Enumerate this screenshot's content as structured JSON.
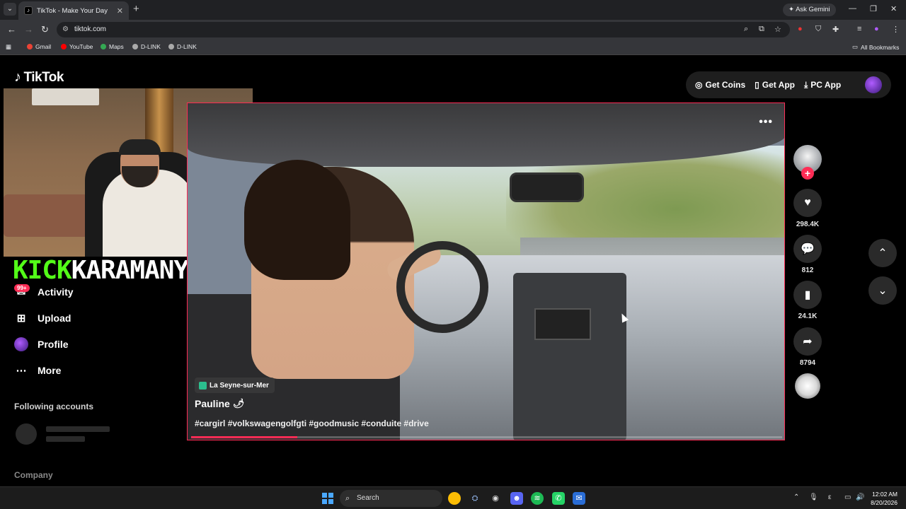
{
  "browser": {
    "tab_title": "TikTok - Make Your Day",
    "ask_gemini": "Ask Gemini",
    "url": "tiktok.com",
    "bookmarks": [
      "Gmail",
      "YouTube",
      "Maps",
      "D-LINK",
      "D-LINK"
    ],
    "all_bookmarks": "All Bookmarks"
  },
  "header": {
    "logo": "TikTok",
    "get_coins": "Get Coins",
    "get_app": "Get App",
    "pc_app": "PC App"
  },
  "overlay": {
    "kick_word": "KICK",
    "streamer_word": "KARAMANY"
  },
  "sidebar": {
    "activity_badge": "99+",
    "items": [
      {
        "label": "Activity",
        "icon": "inbox-icon"
      },
      {
        "label": "Upload",
        "icon": "plus-square-icon"
      },
      {
        "label": "Profile",
        "icon": "avatar"
      },
      {
        "label": "More",
        "icon": "ellipsis-icon"
      }
    ],
    "following_label": "Following accounts",
    "company_label": "Company"
  },
  "video": {
    "location": "La Seyne-sur-Mer",
    "author": "Pauline",
    "author_emoji": "🌶",
    "hashtags": "#cargirl #volkswagengolfgti #goodmusic #conduite #drive",
    "progress": 0.18
  },
  "actions": {
    "likes": "298.4K",
    "comments": "812",
    "saves": "24.1K",
    "shares": "8794"
  },
  "taskbar": {
    "search": "Search",
    "time": "12:02 AM",
    "date": "8/20/2026"
  },
  "colors": {
    "accent": "#fe2c55",
    "kick_green": "#53fc18"
  }
}
